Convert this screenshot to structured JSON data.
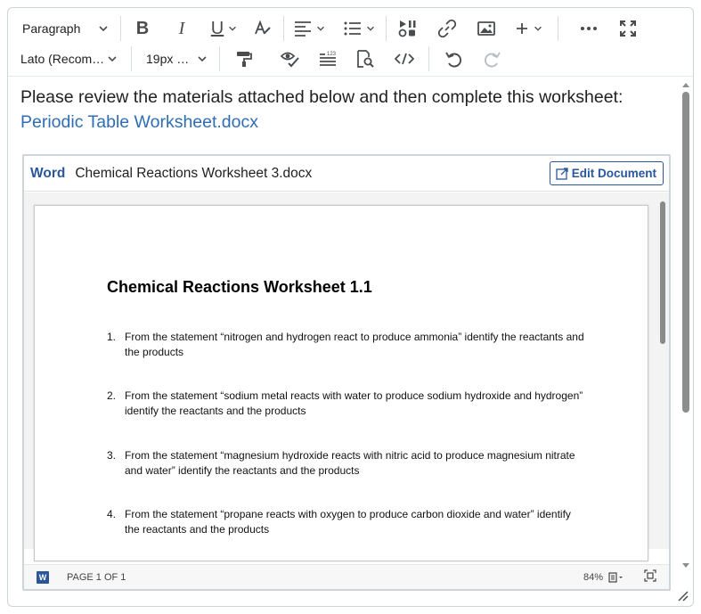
{
  "toolbar": {
    "block_format": "Paragraph",
    "bold_label": "B",
    "italic_label": "I",
    "underline_label": "U",
    "font_family": "Lato (Recom…",
    "font_size": "19px …"
  },
  "content": {
    "intro_text": "Please review the materials attached below and then complete this worksheet:",
    "link_text": "Periodic Table Worksheet.docx"
  },
  "embed": {
    "app_label": "Word",
    "document_name": "Chemical Reactions Worksheet 3.docx",
    "edit_button": "Edit Document",
    "doc_title": "Chemical Reactions Worksheet 1.1",
    "questions": [
      {
        "num": "1.",
        "text": "From the statement “nitrogen and hydrogen react to produce ammonia” identify the reactants and the products"
      },
      {
        "num": "2.",
        "text": "From the statement “sodium metal reacts with water to produce sodium hydroxide and hydrogen” identify the reactants and the products"
      },
      {
        "num": "3.",
        "text": "From the statement “magnesium hydroxide reacts with nitric acid to produce magnesium nitrate and water” identify the reactants and the products"
      },
      {
        "num": "4.",
        "text": "From the statement “propane reacts with oxygen to produce carbon dioxide and water” identify the reactants and the products"
      }
    ],
    "footer": {
      "word_icon_letter": "W",
      "page_count": "PAGE 1 OF 1",
      "zoom": "84%"
    }
  },
  "icons": {
    "colors": {
      "link": "#2f6db5",
      "word_brand": "#2b579a",
      "icon_gray": "#494c4e"
    }
  }
}
